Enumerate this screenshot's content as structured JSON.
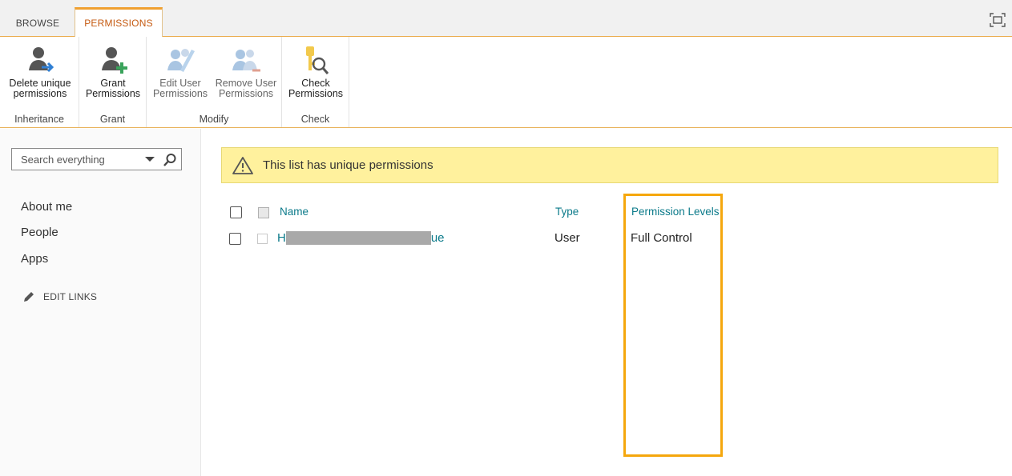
{
  "tabs": {
    "browse": "BROWSE",
    "permissions": "PERMISSIONS"
  },
  "ribbon": {
    "groups": {
      "inheritance": "Inheritance",
      "grant": "Grant",
      "modify": "Modify",
      "check": "Check"
    },
    "buttons": {
      "delete_unique": "Delete unique\npermissions",
      "grant": "Grant\nPermissions",
      "edit_user": "Edit User\nPermissions",
      "remove_user": "Remove User\nPermissions",
      "check": "Check\nPermissions"
    }
  },
  "search": {
    "placeholder": "Search everything"
  },
  "nav": {
    "items": [
      "About me",
      "People",
      "Apps"
    ],
    "edit_links": "EDIT LINKS"
  },
  "banner": {
    "message": "This list has unique permissions"
  },
  "table": {
    "headers": {
      "name": "Name",
      "type": "Type",
      "permission_levels": "Permission Levels"
    },
    "rows": [
      {
        "name_start": "H",
        "name_end": "ue",
        "type": "User",
        "permission_level": "Full Control"
      }
    ]
  },
  "colors": {
    "accent": "#c55a11",
    "link": "#0b7a8a",
    "banner": "#fff19d",
    "highlight": "#f5a70d"
  }
}
